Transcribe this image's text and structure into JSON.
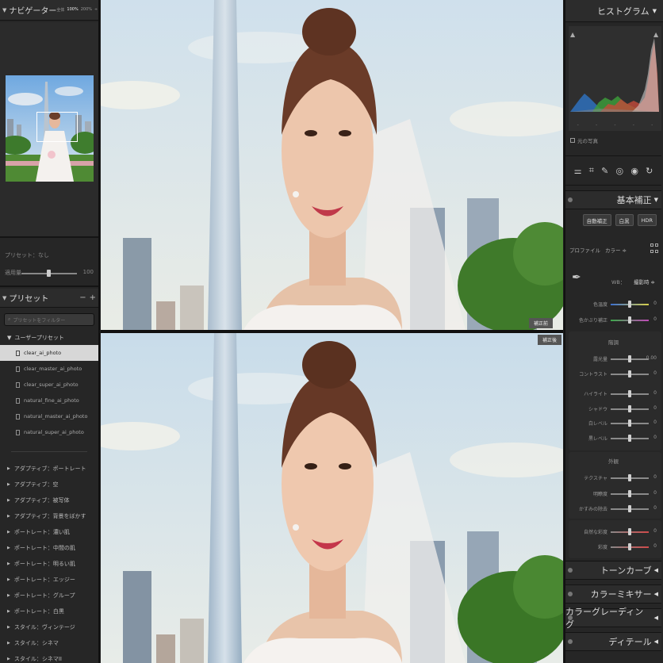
{
  "navigator": {
    "title": "ナビゲーター",
    "zoom_fit": "全体",
    "zoom_100": "100%",
    "zoom_200": "200%"
  },
  "preset_info": {
    "label": "プリセット：なし",
    "amount_label": "適用量",
    "amount_value": "100"
  },
  "presets": {
    "title": "プリセット",
    "add_label": "+",
    "remove_label": "−",
    "filter_placeholder": "プリセットをフィルター",
    "user_folder": "ユーザープリセット",
    "user_items": [
      "clear_ai_photo",
      "clear_master_ai_photo",
      "clear_super_ai_photo",
      "natural_fine_ai_photo",
      "natural_master_ai_photo",
      "natural_super_ai_photo"
    ],
    "selected_index": 0,
    "groups": [
      "アダプティブ：ポートレート",
      "アダプティブ：空",
      "アダプティブ：被写体",
      "アダプティブ：背景をぼかす",
      "ポートレート：濃い肌",
      "ポートレート：中間の肌",
      "ポートレート：明るい肌",
      "ポートレート：エッジー",
      "ポートレート：グループ",
      "ポートレート：白黒",
      "スタイル：ヴィンテージ",
      "スタイル：シネマ",
      "スタイル：シネマII"
    ]
  },
  "view": {
    "before_label": "補正前",
    "after_label": "補正後"
  },
  "histogram": {
    "title": "ヒストグラム",
    "original_photo_label": "元の写真",
    "ticks": [
      "-",
      "-",
      "-",
      "-",
      "-"
    ]
  },
  "tools": {
    "icons": [
      "sliders-icon",
      "crop-icon",
      "heal-icon",
      "mask-icon",
      "redeye-icon",
      "presets-icon"
    ]
  },
  "basic": {
    "title": "基本補正",
    "buttons": [
      "自動補正",
      "白黒",
      "HDR"
    ],
    "profile_label": "プロファイル",
    "profile_value": "カラー ≑",
    "wb_label": "WB：",
    "wb_value": "撮影時 ≑",
    "color_sliders": [
      {
        "label": "色温度",
        "value": "0",
        "pos": 0.5
      },
      {
        "label": "色かぶり補正",
        "value": "0",
        "pos": 0.5
      }
    ],
    "tone_header": "階調",
    "tone_sliders": [
      {
        "label": "露光量",
        "value": "0.00",
        "pos": 0.5
      },
      {
        "label": "コントラスト",
        "value": "0",
        "pos": 0.5
      },
      {
        "label": "ハイライト",
        "value": "0",
        "pos": 0.5
      },
      {
        "label": "シャドウ",
        "value": "0",
        "pos": 0.5
      },
      {
        "label": "白レベル",
        "value": "0",
        "pos": 0.5
      },
      {
        "label": "黒レベル",
        "value": "0",
        "pos": 0.5
      }
    ],
    "presence_header": "外観",
    "presence_sliders": [
      {
        "label": "テクスチャ",
        "value": "0",
        "pos": 0.5
      },
      {
        "label": "明瞭度",
        "value": "0",
        "pos": 0.5
      },
      {
        "label": "かすみの除去",
        "value": "0",
        "pos": 0.5
      }
    ],
    "vib_sliders": [
      {
        "label": "自然な彩度",
        "value": "0",
        "pos": 0.5
      },
      {
        "label": "彩度",
        "value": "0",
        "pos": 0.5
      }
    ]
  },
  "sections": {
    "tone_curve": "トーンカーブ",
    "color_mixer": "カラーミキサー",
    "color_grading": "カラーグレーディング",
    "detail": "ディテール"
  }
}
